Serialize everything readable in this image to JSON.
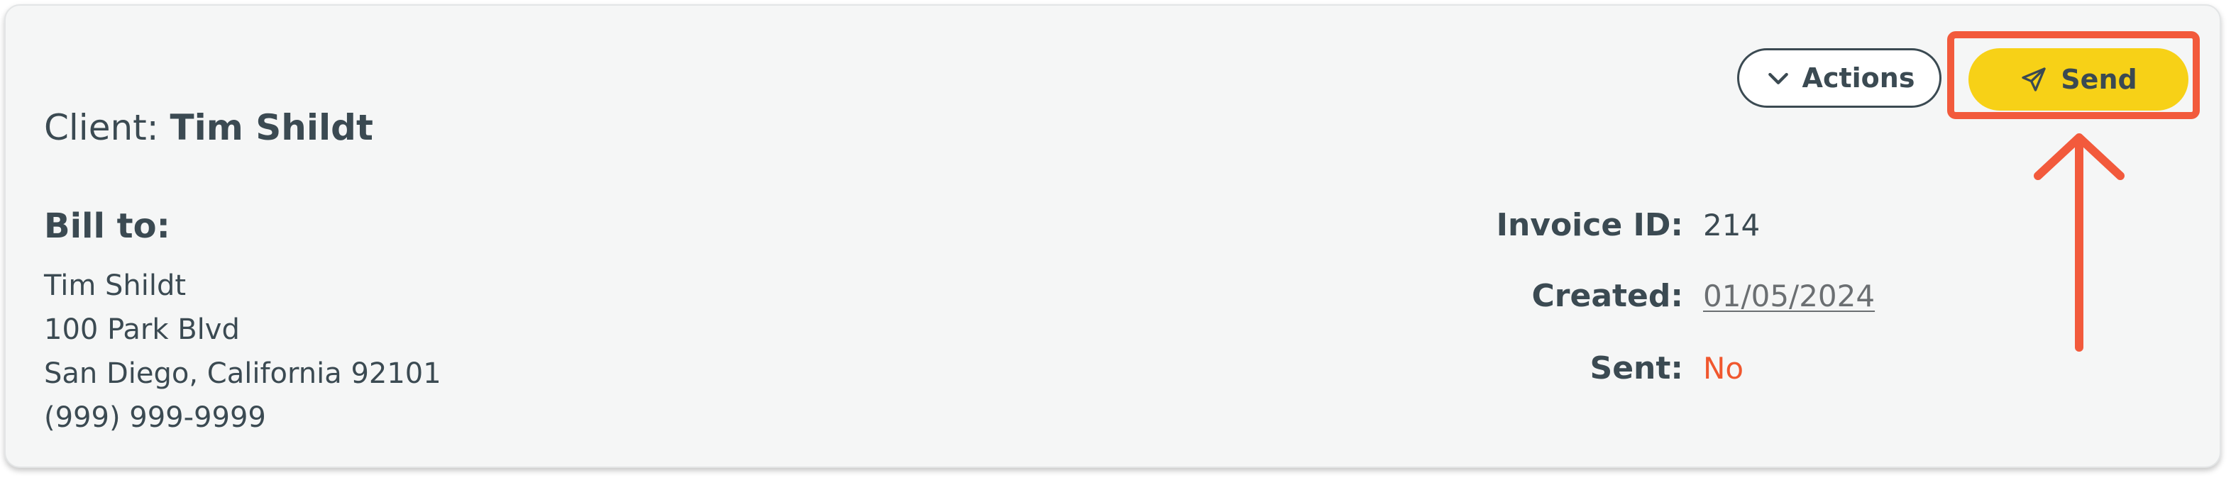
{
  "header": {
    "client_prefix": "Client:",
    "client_name": "Tim Shildt"
  },
  "toolbar": {
    "actions_label": "Actions",
    "send_label": "Send"
  },
  "bill_to": {
    "heading": "Bill to:",
    "lines": [
      "Tim Shildt",
      "100 Park Blvd",
      "San Diego, California 92101",
      "(999) 999-9999"
    ]
  },
  "invoice": {
    "id_label": "Invoice ID:",
    "id_value": "214",
    "created_label": "Created:",
    "created_value": "01/05/2024",
    "sent_label": "Sent:",
    "sent_value": "No"
  },
  "colors": {
    "accent_yellow": "#f7d117",
    "annotation_red": "#f25a3c",
    "status_no": "#f0572e",
    "text_dark": "#3b4a52"
  },
  "icons": {
    "actions": "chevron-down-icon",
    "send": "paper-plane-icon"
  }
}
